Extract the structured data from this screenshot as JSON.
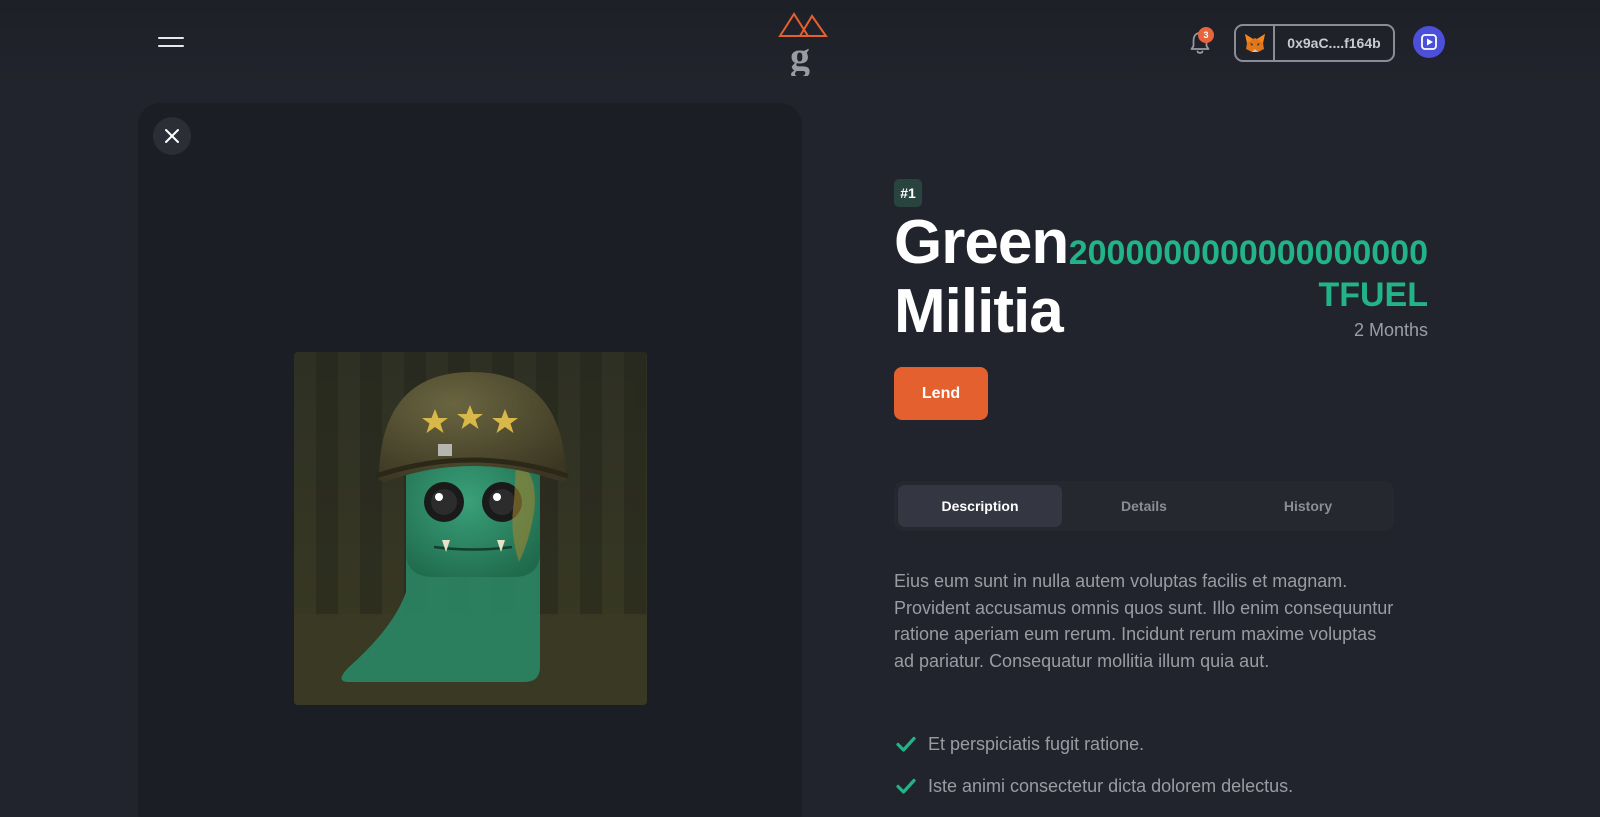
{
  "header": {
    "menu_icon": "hamburger-icon",
    "logo_letter": "g",
    "notification_count": "3",
    "wallet_address": "0x9aC....f164b",
    "wallet_icon": "metamask-fox-icon",
    "avatar_icon": "play-icon"
  },
  "nft": {
    "token_id": "#1",
    "title": "Green Militia",
    "price_amount": "2000000000000000000",
    "price_currency": "TFUEL",
    "duration": "2 Months",
    "lend_label": "Lend"
  },
  "tabs": [
    {
      "label": "Description",
      "active": true
    },
    {
      "label": "Details",
      "active": false
    },
    {
      "label": "History",
      "active": false
    }
  ],
  "description": {
    "text": "Eius eum sunt in nulla autem voluptas facilis et magnam. Provident accusamus omnis quos sunt. Illo enim consequuntur ratione aperiam eum rerum. Incidunt rerum maxime voluptas ad pariatur. Consequatur mollitia illum quia aut.",
    "checklist": [
      "Et perspiciatis fugit ratione.",
      "Iste animi consectetur dicta dolorem delectus."
    ]
  },
  "colors": {
    "accent_orange": "#e4602e",
    "price_green": "#23b388",
    "background": "#22242d"
  }
}
